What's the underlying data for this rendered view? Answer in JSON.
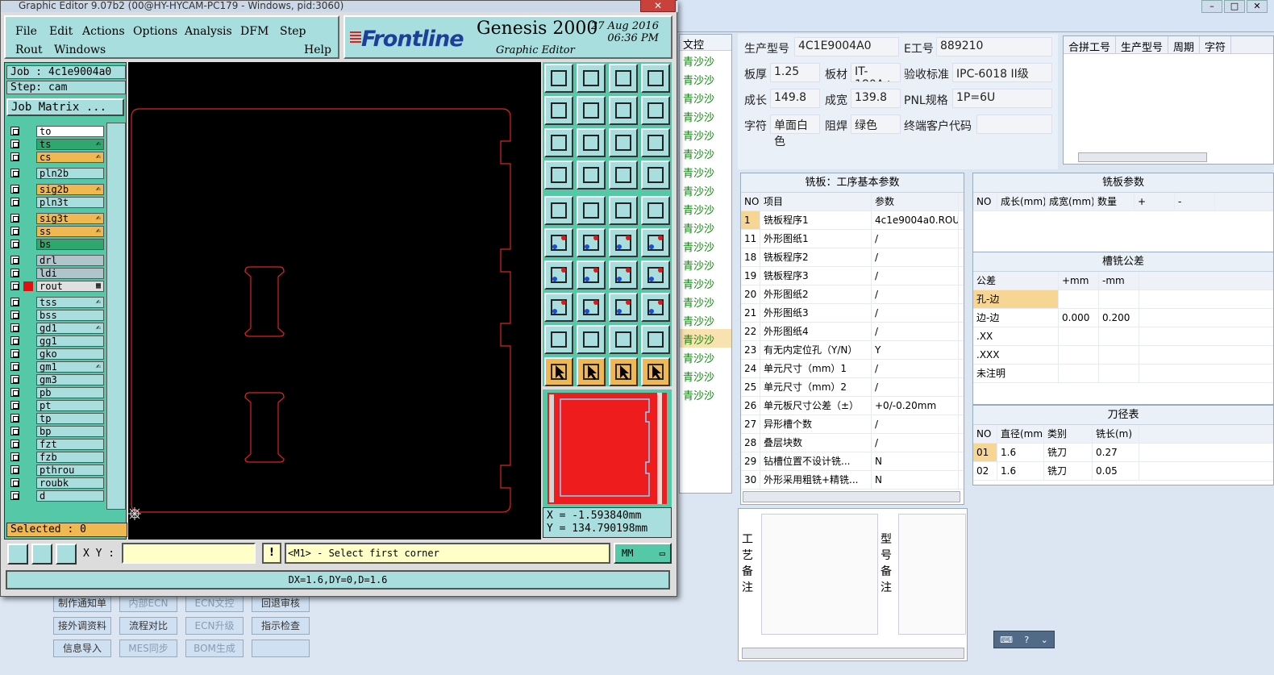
{
  "genesis": {
    "title": "Graphic Editor 9.07b2 (00@HY-HYCAM-PC179 - Windows, pid:3060)",
    "menu": [
      "File",
      "Edit",
      "Actions",
      "Options",
      "Analysis",
      "DFM",
      "Step",
      "Rout",
      "Windows",
      "Help"
    ],
    "logo": {
      "brand": "Frontline",
      "product": "Genesis 2000",
      "subtitle": "Graphic Editor",
      "date": "27 Aug 2016",
      "time": "06:36 PM"
    },
    "job": "Job : 4c1e9004a0",
    "step": "Step: cam",
    "job_matrix": "Job Matrix ...",
    "layers": [
      {
        "name": "to",
        "color": "#ffffff",
        "mark": ""
      },
      {
        "name": "ts",
        "color": "#2fa870",
        "mark": "✍"
      },
      {
        "name": "cs",
        "color": "#f0b850",
        "mark": "✍"
      },
      {
        "name": "pln2b",
        "color": "#a9dede",
        "mark": ""
      },
      {
        "name": "sig2b",
        "color": "#f0b850",
        "mark": "✍"
      },
      {
        "name": "pln3t",
        "color": "#a9dede",
        "mark": ""
      },
      {
        "name": "sig3t",
        "color": "#f0b850",
        "mark": "✍"
      },
      {
        "name": "ss",
        "color": "#f0b850",
        "mark": "✍"
      },
      {
        "name": "bs",
        "color": "#2fa870",
        "mark": ""
      },
      {
        "name": "drl",
        "color": "#b0c4cc",
        "mark": ""
      },
      {
        "name": "ldi",
        "color": "#b0c4cc",
        "mark": ""
      },
      {
        "name": "rout",
        "color": "#e0e0e0",
        "mark": "▦"
      },
      {
        "name": "tss",
        "color": "#a9dede",
        "mark": "✍"
      },
      {
        "name": "bss",
        "color": "#a9dede",
        "mark": ""
      },
      {
        "name": "gd1",
        "color": "#a9dede",
        "mark": "✍"
      },
      {
        "name": "gg1",
        "color": "#a9dede",
        "mark": ""
      },
      {
        "name": "gko",
        "color": "#a9dede",
        "mark": ""
      },
      {
        "name": "gm1",
        "color": "#a9dede",
        "mark": "✍"
      },
      {
        "name": "gm3",
        "color": "#a9dede",
        "mark": ""
      },
      {
        "name": "pb",
        "color": "#a9dede",
        "mark": ""
      },
      {
        "name": "pt",
        "color": "#a9dede",
        "mark": ""
      },
      {
        "name": "tp",
        "color": "#a9dede",
        "mark": ""
      },
      {
        "name": "bp",
        "color": "#a9dede",
        "mark": ""
      },
      {
        "name": "fzt",
        "color": "#a9dede",
        "mark": ""
      },
      {
        "name": "fzb",
        "color": "#a9dede",
        "mark": ""
      },
      {
        "name": "pthrou",
        "color": "#a9dede",
        "mark": ""
      },
      {
        "name": "roubk",
        "color": "#a9dede",
        "mark": ""
      },
      {
        "name": "d",
        "color": "#a9dede",
        "mark": ""
      }
    ],
    "selected": "Selected : 0",
    "coords": {
      "x": "X = -1.593840mm",
      "y": "Y = 134.790198mm"
    },
    "xy_label": "X Y :",
    "prompt": "<M1> - Select first corner",
    "units": "MM",
    "status": "DX=1.6,DY=0,D=1.6"
  },
  "erp": {
    "col_header": "文控",
    "col_values": [
      "青沙沙",
      "青沙沙",
      "青沙沙",
      "青沙沙",
      "青沙沙",
      "青沙沙",
      "青沙沙",
      "青沙沙",
      "青沙沙",
      "青沙沙",
      "青沙沙",
      "青沙沙",
      "青沙沙",
      "青沙沙",
      "青沙沙",
      "青沙沙",
      "青沙沙",
      "青沙沙",
      "青沙沙"
    ],
    "info": {
      "model_label": "生产型号",
      "model": "4C1E9004A0",
      "eno_label": "E工号",
      "eno": "889210",
      "thick_label": "板厚",
      "thick": "1.25",
      "mat_label": "板材",
      "mat": "IT-180A+",
      "std_label": "验收标准",
      "std": "IPC-6018 II级",
      "len_label": "成长",
      "len": "149.8",
      "wid_label": "成宽",
      "wid": "139.8",
      "pnl_label": "PNL规格",
      "pnl": "1P=6U",
      "char_label": "字符",
      "char": "单面白色",
      "mask_label": "阻焊",
      "mask": "绿色",
      "cust_label": "终端客户代码",
      "cust": ""
    },
    "merge_headers": [
      "合拼工号",
      "生产型号",
      "周期",
      "字符"
    ],
    "mill_title": "铣板：工序基本参数",
    "mill_headers": [
      "NO",
      "项目",
      "参数"
    ],
    "mill_rows": [
      [
        "1",
        "铣板程序1",
        "4c1e9004a0.ROU"
      ],
      [
        "11",
        "外形图纸1",
        "/"
      ],
      [
        "18",
        "铣板程序2",
        "/"
      ],
      [
        "19",
        "铣板程序3",
        "/"
      ],
      [
        "20",
        "外形图纸2",
        "/"
      ],
      [
        "21",
        "外形图纸3",
        "/"
      ],
      [
        "22",
        "外形图纸4",
        "/"
      ],
      [
        "23",
        "有无内定位孔（Y/N）",
        "Y"
      ],
      [
        "24",
        "单元尺寸（mm）1",
        "/"
      ],
      [
        "25",
        "单元尺寸（mm）2",
        "/"
      ],
      [
        "26",
        "单元板尺寸公差（±）",
        "+0/-0.20mm"
      ],
      [
        "27",
        "异形槽个数",
        "/"
      ],
      [
        "28",
        "叠层块数",
        "/"
      ],
      [
        "29",
        "钻槽位置不设计铣...",
        "N"
      ],
      [
        "30",
        "外形采用粗铣+精铣...",
        "N"
      ]
    ],
    "board_title": "铣板参数",
    "board_headers": [
      "NO",
      "成长(mm)",
      "成宽(mm)",
      "数量",
      "+",
      "-"
    ],
    "slot_title": "槽铣公差",
    "slot_headers": [
      "公差",
      "+mm",
      "-mm"
    ],
    "slot_rows": [
      [
        "孔-边",
        "",
        ""
      ],
      [
        "边-边",
        "0.000",
        "0.200"
      ],
      [
        ".XX",
        "",
        ""
      ],
      [
        ".XXX",
        "",
        ""
      ],
      [
        "未注明",
        "",
        ""
      ]
    ],
    "tool_title": "刀径表",
    "tool_headers": [
      "NO",
      "直径(mm)",
      "类别",
      "铣长(m)"
    ],
    "tool_rows": [
      [
        "01",
        "1.6",
        "铣刀",
        "0.27"
      ],
      [
        "02",
        "1.6",
        "铣刀",
        "0.05"
      ]
    ],
    "remark1": "工艺备注",
    "remark2": "型号备注",
    "buttons": [
      "制作通知单",
      "内部ECN",
      "ECN文控",
      "回退审核",
      "接外调资料",
      "流程对比",
      "ECN升级",
      "指示检查",
      "信息导入",
      "MES同步",
      "BOM生成",
      ""
    ]
  }
}
